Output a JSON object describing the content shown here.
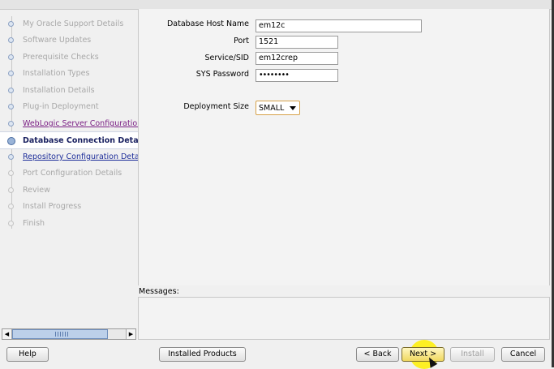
{
  "nav": {
    "steps": [
      {
        "label": "My Oracle Support Details"
      },
      {
        "label": "Software Updates"
      },
      {
        "label": "Prerequisite Checks"
      },
      {
        "label": "Installation Types"
      },
      {
        "label": "Installation Details"
      },
      {
        "label": "Plug-in Deployment"
      },
      {
        "label": "WebLogic Server Configuration"
      },
      {
        "label": "Database Connection Details"
      },
      {
        "label": "Repository Configuration Detai"
      },
      {
        "label": "Port Configuration Details"
      },
      {
        "label": "Review"
      },
      {
        "label": "Install Progress"
      },
      {
        "label": "Finish"
      }
    ],
    "current_step": "Database Connection Details"
  },
  "form": {
    "host_label": "Database Host Name",
    "host_value": "em12c",
    "port_label": "Port",
    "port_value": "1521",
    "sid_label": "Service/SID",
    "sid_value": "em12crep",
    "password_label": "SYS Password",
    "password_value": "••••••••",
    "deployment_label": "Deployment Size",
    "deployment_value": "SMALL"
  },
  "messages": {
    "label": "Messages:"
  },
  "buttons": {
    "help": "Help",
    "installed_products": "Installed Products",
    "back": "< Back",
    "next": "Next >",
    "install": "Install",
    "cancel": "Cancel"
  }
}
